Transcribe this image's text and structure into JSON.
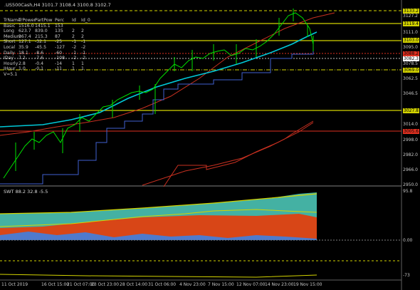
{
  "header": {
    "symbol_line": ".US500Cash,H4  3101.7  3108.4  3100.8  3102.7"
  },
  "table": {
    "headers": [
      "TrName",
      "TrPower",
      "PartPow",
      "Perc",
      "Id",
      "Id_0"
    ],
    "rows": [
      [
        "Basic",
        "1516.0",
        "1415.1",
        "153",
        "",
        ""
      ],
      [
        "Long",
        "623.7",
        "839.0",
        "135",
        "2",
        "2"
      ],
      [
        "Medium",
        "267.4",
        "215.3",
        "87",
        "2",
        "2"
      ],
      [
        "Short",
        "127.1",
        "-32.1",
        "-25",
        "-1",
        "-1"
      ],
      [
        "Local",
        "35.9",
        "-45.5",
        "-127",
        "-2",
        "-2"
      ],
      [
        "Daily",
        "18.1",
        "-8.6",
        "-60",
        "-1",
        "-1"
      ],
      [
        "IDay",
        "7.2",
        "-7.6",
        "-108",
        "-2",
        "-2"
      ],
      [
        "Hourly",
        "2.8",
        "-0.4",
        "-14",
        "1",
        "1"
      ],
      [
        "IHour",
        "1.0",
        "-0.1",
        "-11",
        "1",
        "1"
      ]
    ],
    "footer": "V=5.1"
  },
  "price_axis": {
    "ticks": [
      "3127.2",
      "3111.0",
      "3095.0",
      "3078.5",
      "3062.5",
      "3046.5",
      "3014.0",
      "2998.0",
      "2982.0",
      "2966.0",
      "2950.0"
    ],
    "highlights": [
      {
        "text": "3133.2",
        "bg": "#d4d400"
      },
      {
        "text": "3119.4",
        "bg": "#d4d400"
      },
      {
        "text": "3103.0",
        "bg": "#d4d400"
      },
      {
        "text": "3088.2",
        "bg": "#e03020"
      },
      {
        "text": "3082.3",
        "bg": "#ffffff"
      },
      {
        "text": "3069.0",
        "bg": "#d4d400"
      },
      {
        "text": "3027.8",
        "bg": "#d4d400"
      },
      {
        "text": "3005.6",
        "bg": "#e03020"
      }
    ]
  },
  "indicator": {
    "title": "SWT 88.2 32.8 -5.5",
    "ticks": [
      "95.8",
      "0.00",
      "-73"
    ]
  },
  "time_axis": {
    "labels": [
      "11 Oct 2019",
      "16 Oct 15:00",
      "21 Oct 07:00",
      "23 Oct 23:00",
      "28 Oct 14:00",
      "31 Oct 06:00",
      "4 Nov 23:00",
      "7 Nov 15:00",
      "12 Nov 07:00",
      "14 Nov 23:00",
      "19 Nov 15:00"
    ]
  },
  "colors": {
    "background": "#000000",
    "candles": "#00e000",
    "ma_cyan": "#00c8d8",
    "channel_red": "#c83020",
    "level_yellow": "#d4d400",
    "step_blue": "#4060d0",
    "swt_red": "#e04010",
    "swt_teal": "#50d0c0",
    "swt_blue": "#4080e0"
  }
}
